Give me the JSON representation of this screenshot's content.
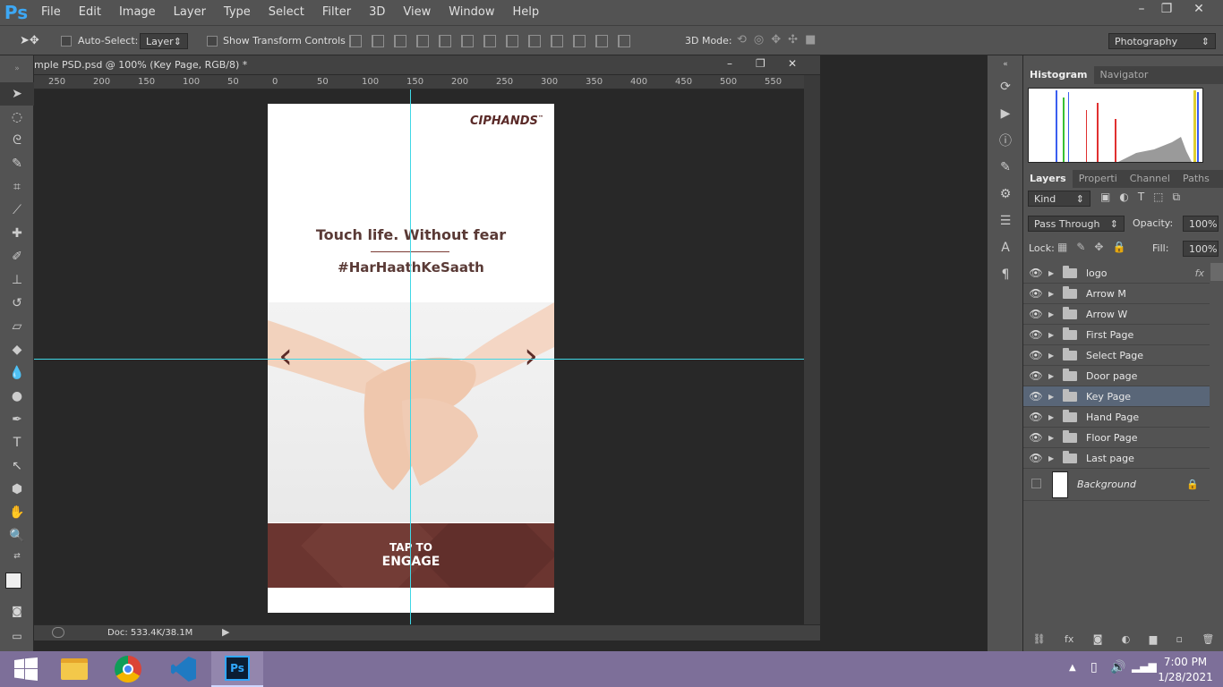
{
  "app": {
    "logo": "Ps"
  },
  "menu": [
    "File",
    "Edit",
    "Image",
    "Layer",
    "Type",
    "Select",
    "Filter",
    "3D",
    "View",
    "Window",
    "Help"
  ],
  "window_controls": {
    "minimize": "–",
    "restore": "❐",
    "close": "✕"
  },
  "options_bar": {
    "auto_select_label": "Auto-Select:",
    "auto_select_value": "Layer",
    "show_transform_label": "Show Transform Controls",
    "mode_3d_label": "3D Mode:",
    "workspace": "Photography"
  },
  "document": {
    "title": "mple PSD.psd @ 100% (Key Page, RGB/8) *",
    "ruler_ticks": [
      "250",
      "200",
      "150",
      "100",
      "50",
      "0",
      "50",
      "100",
      "150",
      "200",
      "250",
      "300",
      "350",
      "400",
      "450",
      "500",
      "550"
    ],
    "status": "Doc: 533.4K/38.1M"
  },
  "artboard": {
    "brand": "CIPHANDS",
    "brand_tm": "™",
    "headline": "Touch life. Without fear",
    "hashtag": "#HarHaathKeSaath",
    "cta_top": "TAP TO",
    "cta_bottom": "ENGAGE",
    "arrow_left": "‹",
    "arrow_right": "›",
    "cta_color": "#6b3530",
    "text_color": "#5a3a36"
  },
  "panels": {
    "top_tabs": [
      "Histogram",
      "Navigator"
    ],
    "layer_tabs": [
      "Layers",
      "Properti",
      "Channel",
      "Paths"
    ],
    "filter_kind": "Kind",
    "blend_mode": "Pass Through",
    "opacity_label": "Opacity:",
    "opacity_value": "100%",
    "lock_label": "Lock:",
    "fill_label": "Fill:",
    "fill_value": "100%",
    "fx_label": "fx",
    "layers": [
      "logo",
      "Arrow M",
      "Arrow W",
      "First Page",
      "Select Page",
      "Door page",
      "Key Page",
      "Hand Page",
      "Floor Page",
      "Last page"
    ],
    "selected_layer": "Key Page",
    "background_layer": "Background"
  },
  "taskbar": {
    "time": "7:00 PM",
    "date": "1/28/2021",
    "ps_label": "Ps"
  }
}
